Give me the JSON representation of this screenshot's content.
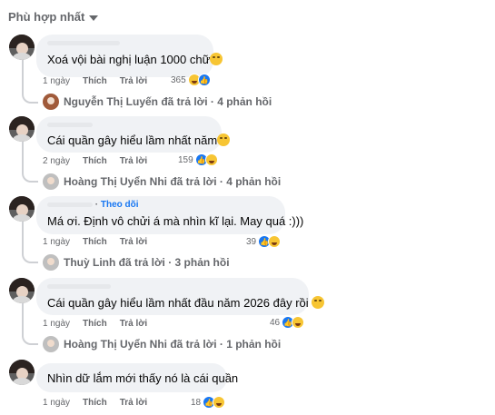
{
  "sort": {
    "label": "Phù hợp nhất",
    "icon": "caret-down-icon"
  },
  "comments": [
    {
      "author": "",
      "text": "Xoá vội bài nghị luận 1000 chữ",
      "emoji": "rolling-laugh-emoji",
      "time": "1 ngày",
      "like_label": "Thích",
      "reply_label": "Trả lời",
      "reaction_count": "365",
      "replies": "Nguyễn Thị Luyến đã trả lời · 4 phản hồi"
    },
    {
      "author": "",
      "text": "Cái quần gây hiểu lầm nhất năm",
      "emoji": "grin-emoji",
      "time": "2 ngày",
      "like_label": "Thích",
      "reply_label": "Trả lời",
      "reaction_count": "159",
      "replies": "Hoàng Thị Uyển Nhi đã trả lời · 4 phản hồi"
    },
    {
      "author": "",
      "follow_label": "Theo dõi",
      "text": "Má ơi. Định vô chửi á mà nhìn kĩ lại. May quá :)))",
      "time": "1 ngày",
      "like_label": "Thích",
      "reply_label": "Trả lời",
      "reaction_count": "39",
      "replies": "Thuỳ Linh đã trả lời · 3 phản hồi"
    },
    {
      "author": "",
      "text": "Cái quần gây hiểu lầm nhất đầu năm 2026 đây rồi",
      "emoji": "grin-emoji",
      "time": "1 ngày",
      "like_label": "Thích",
      "reply_label": "Trả lời",
      "reaction_count": "46",
      "replies": "Hoàng Thị Uyển Nhi đã trả lời · 1 phản hồi"
    },
    {
      "author": "",
      "text": "Nhìn dữ lắm mới thấy nó là cái quần",
      "time": "1 ngày",
      "like_label": "Thích",
      "reply_label": "Trả lời",
      "reaction_count": "18"
    }
  ],
  "colors": {
    "accent": "#1877f2",
    "bubble": "#f0f2f5",
    "muted": "#65676b",
    "line": "#ced0d4"
  }
}
